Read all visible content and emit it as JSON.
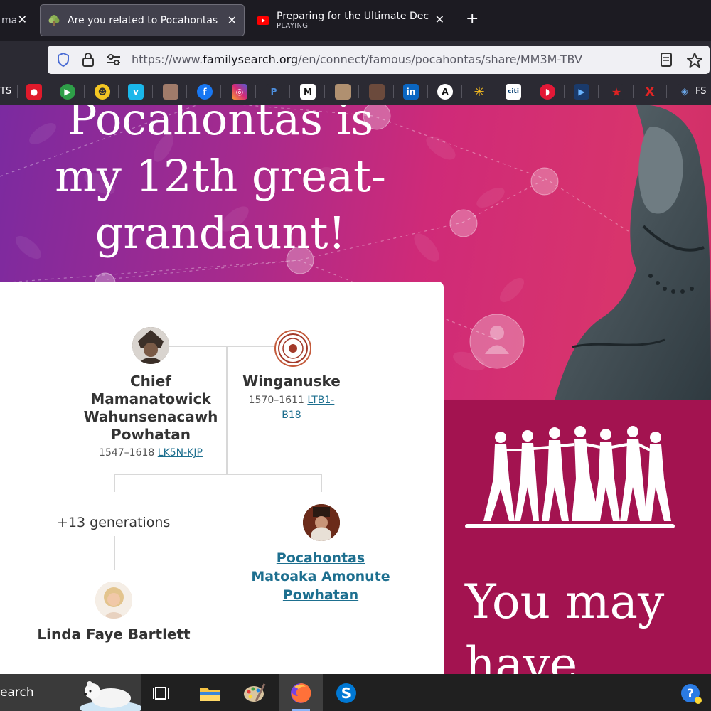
{
  "browser": {
    "tabs": [
      {
        "title": "ma",
        "state": "partial"
      },
      {
        "title": "Are you related to Pocahontas?",
        "state": "active"
      },
      {
        "title": "Preparing for the Ultimate Dece",
        "subtitle": "PLAYING",
        "state": "inactive"
      }
    ],
    "url": {
      "prefix": "https://www.",
      "host": "familysearch.org",
      "path": "/en/connect/famous/pocahontas/share/MM3M-TBV"
    },
    "bookmarks": {
      "left_text": "TS",
      "right_text": "FS"
    }
  },
  "page": {
    "headline": {
      "line1": "Pocahontas is",
      "line2": "my 12th great-",
      "line3": "grandaunt!"
    },
    "tree": {
      "father": {
        "name": "Chief Mamanatowick Wahunsenacawh Powhatan",
        "dates": "1547–1618",
        "id": "LK5N-KJP"
      },
      "mother": {
        "name": "Winganuske",
        "dates": "1570–1611",
        "id": "LTB1-B18"
      },
      "generations": "+13 generations",
      "famous_person": "Pocahontas Matoaka Amonute Powhatan",
      "user": "Linda Faye Bartlett"
    },
    "promo": {
      "title_line1": "You may",
      "title_line2": "have"
    }
  },
  "taskbar": {
    "search_text": "earch"
  },
  "colors": {
    "accent_link": "#1d6f8f",
    "promo_bg": "#a31350",
    "hero_start": "#7b2aa0",
    "hero_end": "#d8346c"
  }
}
